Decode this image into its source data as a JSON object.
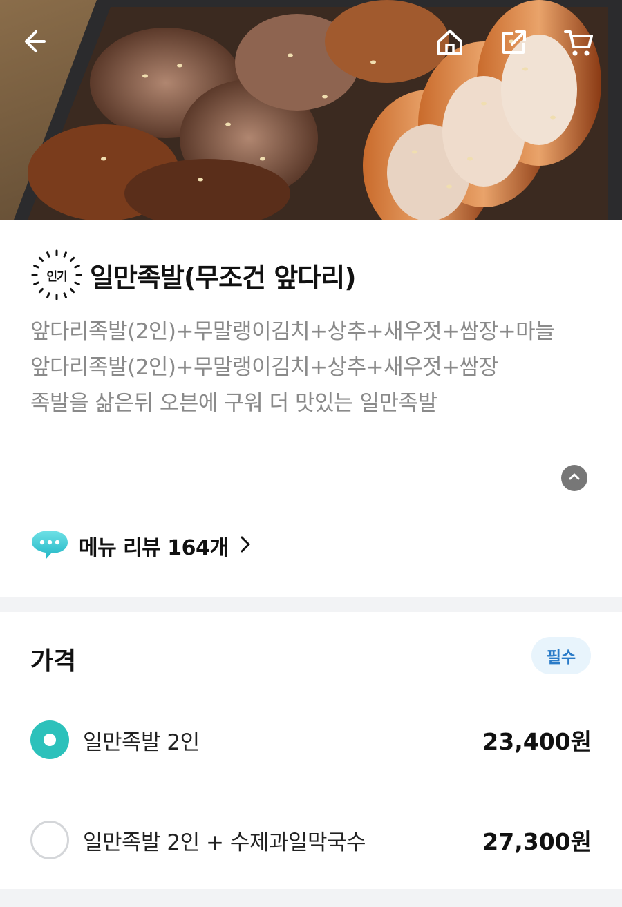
{
  "header": {
    "icons": [
      "back-arrow-icon",
      "home-icon",
      "share-icon",
      "cart-icon"
    ]
  },
  "menu": {
    "badge": "인기",
    "title": "일만족발(무조건 앞다리)",
    "description": [
      "앞다리족발(2인)+무말랭이김치+상추+새우젓+쌈장+마늘",
      "앞다리족발(2인)+무말랭이김치+상추+새우젓+쌈장",
      "족발을 삶은뒤 오븐에 구워 더 맛있는 일만족발"
    ],
    "review_link": "메뉴 리뷰 164개"
  },
  "price": {
    "heading": "가격",
    "required_label": "필수",
    "options": [
      {
        "label": "일만족발 2인",
        "price": "23,400원",
        "selected": true
      },
      {
        "label": "일만족발 2인 + 수제과일막국수",
        "price": "27,300원",
        "selected": false
      }
    ]
  },
  "colors": {
    "accent": "#2cc1bb",
    "required_text": "#2a7bc8",
    "required_bg": "#e8f4fc",
    "description_text": "#8a8a8a"
  }
}
